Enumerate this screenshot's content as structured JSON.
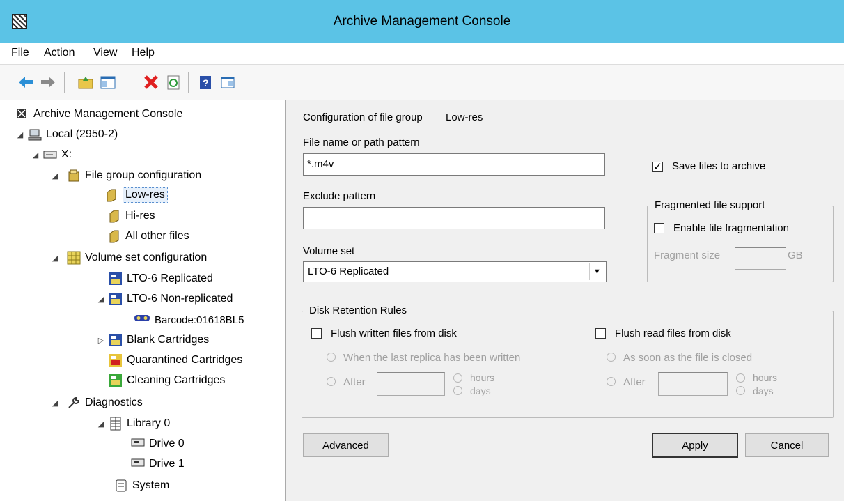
{
  "window": {
    "title": "Archive Management Console"
  },
  "menu": [
    "File",
    "Action",
    "View",
    "Help"
  ],
  "toolbar": [
    "back-icon",
    "forward-icon",
    "up-folder-icon",
    "show-hide-tree-icon",
    "delete-icon",
    "refresh-icon",
    "help-icon",
    "properties-icon"
  ],
  "tree": {
    "root": "Archive Management Console",
    "local": "Local (2950-2)",
    "drive": "X:",
    "file_group_config": "File group configuration",
    "low_res": "Low-res",
    "hi_res": "Hi-res",
    "all_other": "All other files",
    "volume_set_config": "Volume set configuration",
    "lto6_replicated": "LTO-6 Replicated",
    "lto6_nonreplicated": "LTO-6 Non-replicated",
    "barcode": "Barcode:01618BL5",
    "blank": "Blank Cartridges",
    "quarantined": "Quarantined Cartridges",
    "cleaning": "Cleaning Cartridges",
    "diagnostics": "Diagnostics",
    "library": "Library 0",
    "drive0": "Drive 0",
    "drive1": "Drive 1",
    "system": "System"
  },
  "form": {
    "config_label": "Configuration of file group",
    "config_name": "Low-res",
    "pattern_label": "File name or path pattern",
    "pattern_value": "*.m4v",
    "exclude_label": "Exclude pattern",
    "exclude_value": "",
    "volume_label": "Volume set",
    "volume_value": "LTO-6 Replicated",
    "save_label": "Save files to archive",
    "frag_group": "Fragmented file support",
    "frag_enable": "Enable file fragmentation",
    "frag_size_label": "Fragment size",
    "frag_unit": "GB",
    "retention_group": "Disk Retention Rules",
    "flush_written": "Flush written files from disk",
    "when_last_replica": "When the last replica has been written",
    "after": "After",
    "hours": "hours",
    "days": "days",
    "flush_read": "Flush read files from disk",
    "as_soon_closed": "As soon as the file is closed",
    "advanced": "Advanced",
    "apply": "Apply",
    "cancel": "Cancel"
  }
}
